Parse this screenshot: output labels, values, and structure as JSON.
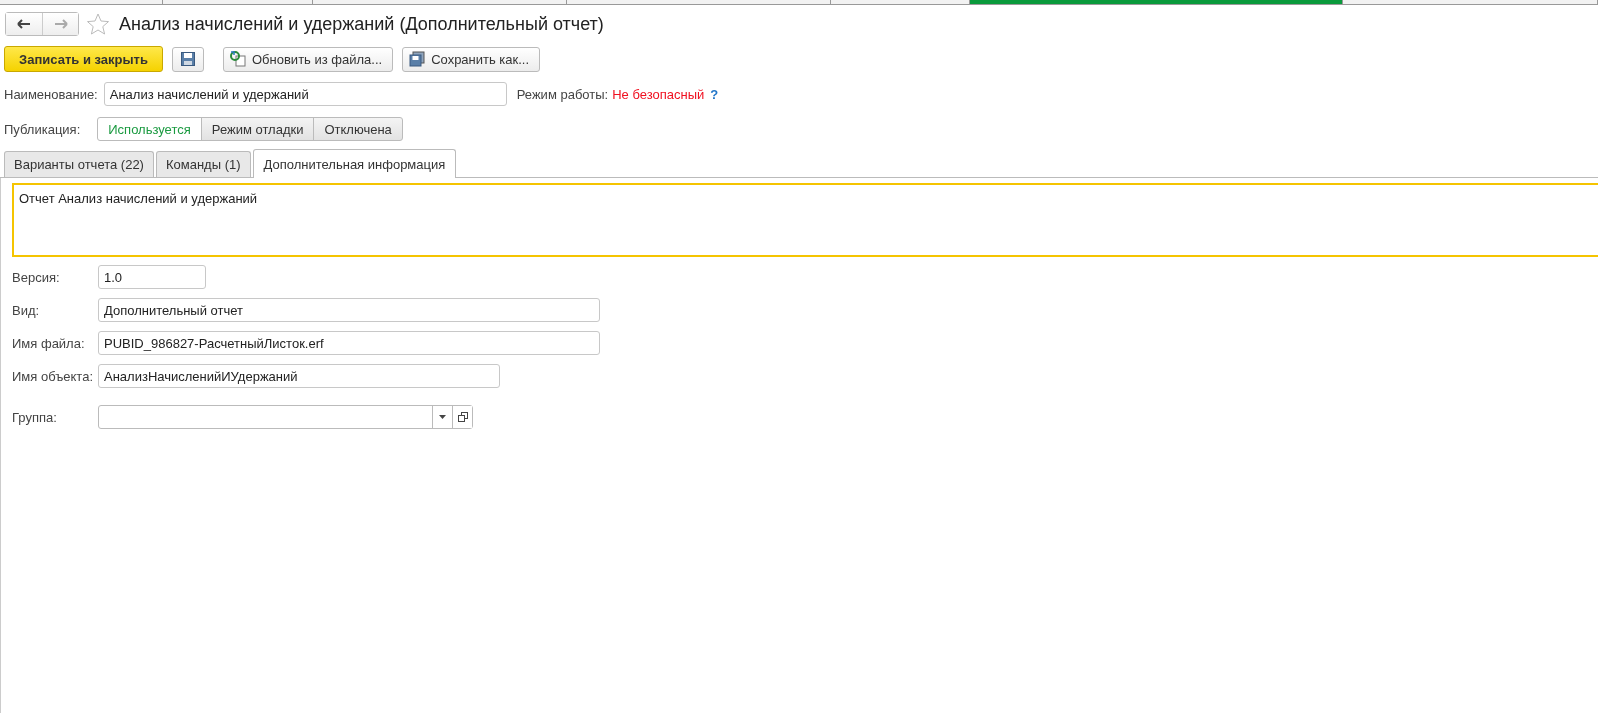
{
  "top_tabs": [
    {
      "selected": false
    },
    {
      "selected": false
    },
    {
      "selected": false
    },
    {
      "selected": false
    },
    {
      "selected": false
    },
    {
      "selected": true
    },
    {
      "selected": false
    }
  ],
  "header": {
    "title": "Анализ начислений и удержаний (Дополнительный отчет)",
    "favorite": false
  },
  "toolbar": {
    "primary": "Записать и закрыть",
    "buttons": [
      {
        "label": "Обновить из файла...",
        "kind": "update"
      },
      {
        "label": "Сохранить как...",
        "kind": "save"
      }
    ]
  },
  "name_field": {
    "label": "Наименование:",
    "value": "Анализ начислений и удержаний"
  },
  "mode": {
    "label": "Режим работы:",
    "value": "Не безопасный",
    "help": "?"
  },
  "publication": {
    "label": "Публикация:",
    "options": [
      {
        "label": "Используется",
        "selected": true
      },
      {
        "label": "Режим отладки",
        "selected": false
      },
      {
        "label": "Отключена",
        "selected": false
      }
    ]
  },
  "tabs": [
    {
      "label": "Варианты отчета (22)",
      "selected": false
    },
    {
      "label": "Команды (1)",
      "selected": false
    },
    {
      "label": "Дополнительная информация",
      "selected": true
    }
  ],
  "description": "Отчет Анализ начислений и удержаний",
  "fields": [
    {
      "label": "Версия:",
      "value": "1.0"
    },
    {
      "label": "Вид:",
      "value": "Дополнительный отчет"
    },
    {
      "label": "Имя файла:",
      "value": "PUBID_986827-РасчетныйЛисток.erf"
    },
    {
      "label": "Имя объекта:",
      "value": "АнализНачисленийИУдержаний"
    }
  ],
  "group": {
    "label": "Группа:"
  }
}
